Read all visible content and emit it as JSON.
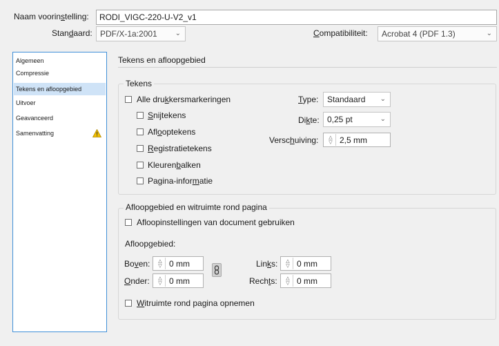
{
  "header": {
    "preset_label_pre": "Naam voorin",
    "preset_label_u": "s",
    "preset_label_post": "telling:",
    "preset_value": "RODI_VIGC-220-U-V2_v1",
    "standard_label_pre": "Stan",
    "standard_label_u": "d",
    "standard_label_post": "aard:",
    "standard_value": "PDF/X-1a:2001",
    "compat_label_pre": "",
    "compat_label_u": "C",
    "compat_label_post": "ompatibiliteit:",
    "compat_value": "Acrobat 4 (PDF 1.3)"
  },
  "sidebar": {
    "items": [
      {
        "label": "Algemeen"
      },
      {
        "label": "Compressie"
      },
      {
        "label": "Tekens en afloopgebied"
      },
      {
        "label": "Uitvoer"
      },
      {
        "label": "Geavanceerd"
      },
      {
        "label": "Samenvatting"
      }
    ]
  },
  "section": {
    "title": "Tekens en afloopgebied"
  },
  "marks": {
    "legend": "Tekens",
    "all_pre": "Alle dru",
    "all_u": "k",
    "all_post": "kersmarkeringen",
    "crop_pre": "",
    "crop_u": "S",
    "crop_post": "nijtekens",
    "bleed_pre": "Afl",
    "bleed_u": "o",
    "bleed_post": "optekens",
    "reg_pre": "",
    "reg_u": "R",
    "reg_post": "egistratietekens",
    "color_pre": "Kleuren",
    "color_u": "b",
    "color_post": "alken",
    "page_pre": "Pagina-infor",
    "page_u": "m",
    "page_post": "atie",
    "type_label_pre": "",
    "type_label_u": "T",
    "type_label_post": "ype:",
    "type_value": "Standaard",
    "weight_label_pre": "Di",
    "weight_label_u": "k",
    "weight_label_post": "te:",
    "weight_value": "0,25 pt",
    "offset_label_pre": "Versc",
    "offset_label_u": "h",
    "offset_label_post": "uiving:",
    "offset_value": "2,5 mm"
  },
  "bleed": {
    "legend": "Afloopgebied en witruimte rond pagina",
    "use_doc_pre": "Afloopinstellingen van document ",
    "use_doc_u": "g",
    "use_doc_post": "ebruiken",
    "heading": "Afloopgebied:",
    "top_label_pre": "Bo",
    "top_label_u": "v",
    "top_label_post": "en:",
    "top_value": "0 mm",
    "bottom_label_pre": "",
    "bottom_label_u": "O",
    "bottom_label_post": "nder:",
    "bottom_value": "0 mm",
    "left_label_pre": "Lin",
    "left_label_u": "k",
    "left_label_post": "s:",
    "left_value": "0 mm",
    "right_label_pre": "Rech",
    "right_label_u": "t",
    "right_label_post": "s:",
    "right_value": "0 mm",
    "slug_pre": "",
    "slug_u": "W",
    "slug_post": "itruimte rond pagina opnemen"
  }
}
